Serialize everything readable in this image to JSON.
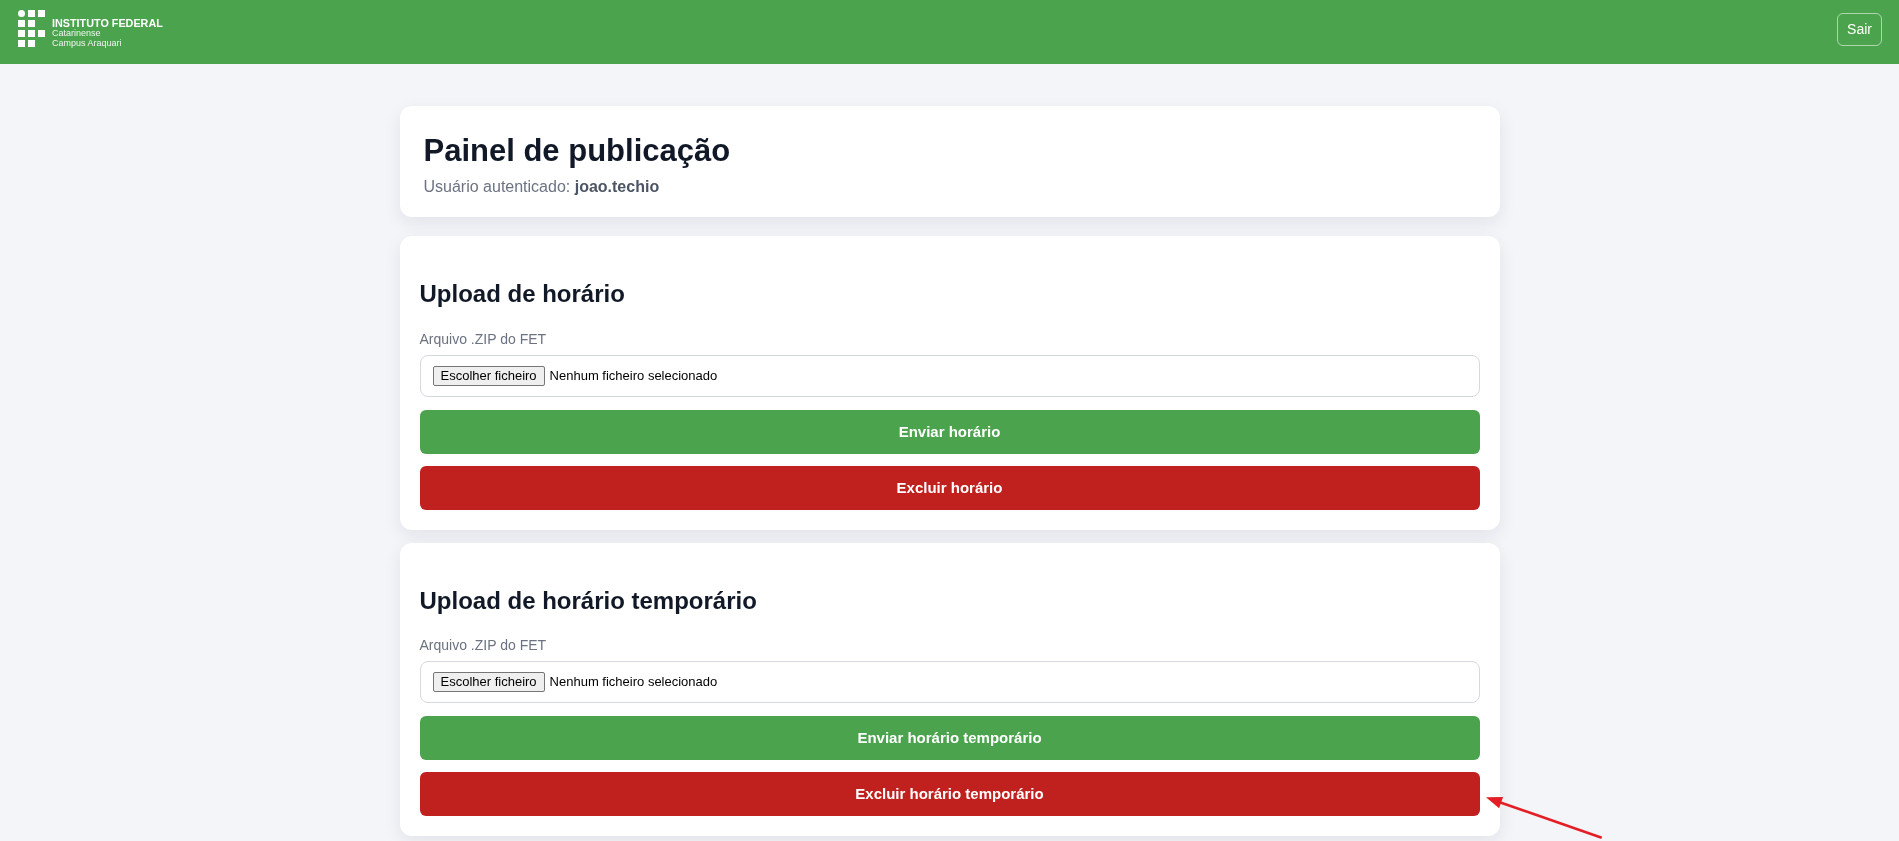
{
  "header": {
    "logo": {
      "title": "INSTITUTO FEDERAL",
      "lines": [
        "Catarinense",
        "Campus Araquari"
      ]
    },
    "logout_button": "Sair"
  },
  "panel": {
    "title": "Painel de publicação",
    "user_line": "Usuário autenticado: **joao.techio**"
  },
  "upload_sections": [
    {
      "title": "Upload de horário",
      "field_label": "Arquivo .ZIP do FET",
      "file_button": "Escolher ficheiro",
      "file_status": "Nenhum ficheiro selecionado",
      "actions": [
        {
          "label": "Enviar horário",
          "kind": "submit"
        },
        {
          "label": "Excluir horário",
          "kind": "delete"
        }
      ]
    },
    {
      "title": "Upload de horário temporário",
      "field_label": "Arquivo .ZIP do FET",
      "file_button": "Escolher ficheiro",
      "file_status": "Nenhum ficheiro selecionado",
      "actions": [
        {
          "label": "Enviar horário temporário",
          "kind": "submit"
        },
        {
          "label": "Excluir horário temporário",
          "kind": "delete"
        }
      ]
    }
  ]
}
